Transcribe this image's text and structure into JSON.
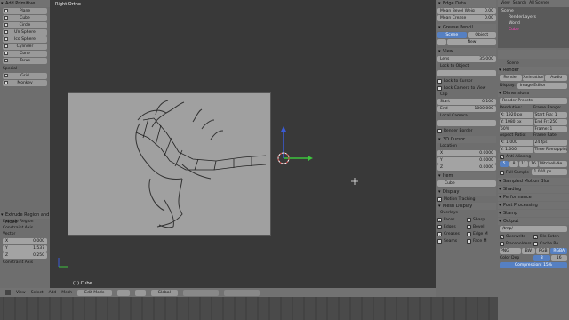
{
  "top_bar": {
    "engine": "Blender Render",
    "right_tabs": [
      "View",
      "Search",
      "All Scenes"
    ]
  },
  "left_panel": {
    "add_mesh_title": "Add Primitive",
    "meshes": [
      "Plane",
      "Cube",
      "Circle",
      "UV Sphere",
      "Ico Sphere",
      "Cylinder",
      "Cone",
      "Torus"
    ],
    "special_label": "Special",
    "special": [
      "Grid",
      "Monkey"
    ],
    "op_title": "Extrude Region and Move",
    "op_lines": [
      "Extrude Region",
      "Constraint Axis"
    ],
    "vector_label": "Vector",
    "vec": [
      {
        "a": "X",
        "v": "0.000"
      },
      {
        "a": "Y",
        "v": "1.537"
      },
      {
        "a": "Z",
        "v": "0.250"
      }
    ],
    "orient_label": "Constraint Axis"
  },
  "viewport": {
    "view_label": "Right Ortho",
    "object_label": "(1) Cube"
  },
  "bottom_bar": {
    "items": [
      "View",
      "Select",
      "Add",
      "Mesh"
    ],
    "mode": "Edit Mode",
    "pivot": "Global"
  },
  "mid_panel": {
    "edge_title": "Edge Data",
    "mean_bevel": {
      "label": "Mean Bevel Weig",
      "value": "0.00"
    },
    "mean_crease": {
      "label": "Mean Crease",
      "value": "0.00"
    },
    "grease_title": "Grease Pencil",
    "scene_tab": "Scene",
    "object_tab": "Object",
    "new_btn": "New",
    "view_title": "View",
    "lens": {
      "label": "Lens",
      "value": "35.000"
    },
    "lock_to_object": "Lock to Object",
    "lock_cursor": "Lock to Cursor",
    "lock_camera": "Lock Camera to View",
    "clip_label": "Clip",
    "clip_start": {
      "label": "Start",
      "value": "0.100"
    },
    "clip_end": {
      "label": "End",
      "value": "1000.000"
    },
    "local_camera": "Local Camera",
    "render_border": "Render Border",
    "cursor_title": "3D Cursor",
    "location_label": "Location",
    "cursor_loc": [
      {
        "a": "X",
        "v": "0.0000"
      },
      {
        "a": "Y",
        "v": "0.0000"
      },
      {
        "a": "Z",
        "v": "0.0000"
      }
    ],
    "item_title": "Item",
    "item_name": "Cube",
    "display_title": "Display",
    "motion_title": "Motion Tracking",
    "mesh_display_title": "Mesh Display",
    "overlays_label": "Overlays",
    "overlays": [
      {
        "l": "Faces",
        "r": "Sharp"
      },
      {
        "l": "Edges",
        "r": "Bevel"
      },
      {
        "l": "Creases",
        "r": "Edge M"
      },
      {
        "l": "Seams",
        "r": "Face M"
      }
    ]
  },
  "right_panel": {
    "outliner": [
      "Scene",
      "RenderLayers",
      "World",
      "Cube"
    ],
    "scene_label": "Scene",
    "render_title": "Render",
    "render_buttons": [
      "Render",
      "Animation",
      "Audio"
    ],
    "display_label": "Display:",
    "display_value": "Image Editor",
    "dimensions_title": "Dimensions",
    "render_presets": "Render Presets",
    "resolution_label": "Resolution:",
    "frame_range_label": "Frame Range:",
    "res": [
      {
        "l": "X: 1920 px",
        "r": "Start Fra: 1"
      },
      {
        "l": "Y: 1080 px",
        "r": "End Fr: 250"
      },
      {
        "l": "50%",
        "r": "Frame: 1"
      }
    ],
    "aspect_label": "Aspect Ratio:",
    "frame_rate_label": "Frame Rate:",
    "aspect": [
      {
        "l": "X: 1.000",
        "r": "24 fps"
      },
      {
        "l": "Y: 1.000",
        "r": "Time Remapping"
      }
    ],
    "aa_title": "Anti-Aliasing",
    "aa_values": [
      "5",
      "8",
      "11",
      "16"
    ],
    "aa_filter": "Mitchell-Ne...",
    "full_sample": "Full Sample",
    "full_sample_val": "1.000 px",
    "sections": [
      "Sampled Motion Blur",
      "Shading",
      "Performance",
      "Post Processing",
      "Stamp",
      "Output"
    ],
    "output_path": "/tmp/",
    "overwrite": "Overwrite",
    "file_ext": "File Exten",
    "placeholders": "Placeholders",
    "cache_res": "Cache Re",
    "format_opts": [
      "PNG",
      "BW",
      "RGB",
      "RGBA"
    ],
    "color_depth_label": "Color Dep",
    "color_depth": [
      "8",
      "16"
    ],
    "compression": "Compression: 15%"
  },
  "colors": {
    "panel": "#6e6e6e",
    "viewport": "#393939",
    "canvas": "#a0a0a0",
    "accent": "#5680c2",
    "green_axis": "#3ec43e",
    "blue_axis": "#3a5bd6"
  }
}
